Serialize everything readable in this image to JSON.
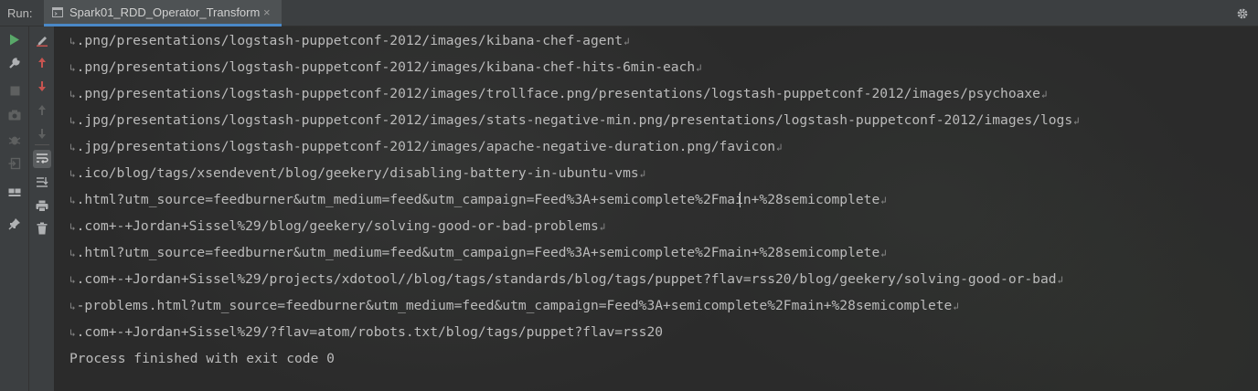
{
  "topbar": {
    "run_label": "Run:",
    "tab_label": "Spark01_RDD_Operator_Transform",
    "close_glyph": "×",
    "settings_icon": "gear-icon"
  },
  "toolbar_left": [
    {
      "name": "rerun-icon",
      "color": "#59a869"
    },
    {
      "name": "wrench-icon",
      "color": "#afb1b3"
    },
    {
      "name": "stop-icon",
      "color": "#5e6060"
    },
    {
      "name": "camera-icon",
      "color": "#5e6060"
    },
    {
      "name": "bug-icon",
      "color": "#5e6060"
    },
    {
      "name": "exit-icon",
      "color": "#5e6060"
    },
    {
      "name": "layout-icon",
      "color": "#afb1b3"
    },
    {
      "name": "pin-icon",
      "color": "#afb1b3"
    }
  ],
  "toolbar_right": [
    {
      "name": "edit-config-icon",
      "color": "#c75450"
    },
    {
      "name": "arrow-up-icon",
      "color": "#c75450"
    },
    {
      "name": "arrow-down-icon",
      "color": "#c75450"
    },
    {
      "name": "arrow-up-gray-icon",
      "color": "#5e6060"
    },
    {
      "name": "arrow-down-gray-icon",
      "color": "#5e6060"
    },
    {
      "name": "soft-wrap-icon",
      "color": "#afb1b3"
    },
    {
      "name": "scroll-to-end-icon",
      "color": "#afb1b3"
    },
    {
      "name": "print-icon",
      "color": "#afb1b3"
    },
    {
      "name": "trash-icon",
      "color": "#afb1b3"
    }
  ],
  "console": {
    "lines": [
      ".png/presentations/logstash-puppetconf-2012/images/kibana-chef-agent",
      ".png/presentations/logstash-puppetconf-2012/images/kibana-chef-hits-6min-each",
      ".png/presentations/logstash-puppetconf-2012/images/trollface.png/presentations/logstash-puppetconf-2012/images/psychoaxe",
      ".jpg/presentations/logstash-puppetconf-2012/images/stats-negative-min.png/presentations/logstash-puppetconf-2012/images/logs",
      ".jpg/presentations/logstash-puppetconf-2012/images/apache-negative-duration.png/favicon",
      ".ico/blog/tags/xsendevent/blog/geekery/disabling-battery-in-ubuntu-vms",
      ".html?utm_source=feedburner&utm_medium=feed&utm_campaign=Feed%3A+semicomplete%2Fmain+%28semicomplete",
      ".com+-+Jordan+Sissel%29/blog/geekery/solving-good-or-bad-problems",
      ".html?utm_source=feedburner&utm_medium=feed&utm_campaign=Feed%3A+semicomplete%2Fmain+%28semicomplete",
      ".com+-+Jordan+Sissel%29/projects/xdotool//blog/tags/standards/blog/tags/puppet?flav=rss20/blog/geekery/solving-good-or-bad",
      "-problems.html?utm_source=feedburner&utm_medium=feed&utm_campaign=Feed%3A+semicomplete%2Fmain+%28semicomplete",
      ".com+-+Jordan+Sissel%29/?flav=atom/robots.txt/blog/tags/puppet?flav=rss20"
    ],
    "wrap_start_glyph": "↳",
    "wrap_end_glyph": "↲",
    "finish_message": "Process finished with exit code 0"
  },
  "colors": {
    "accent": "#4a88c7",
    "text": "#bbbbbb",
    "background": "#2b2b2b"
  }
}
